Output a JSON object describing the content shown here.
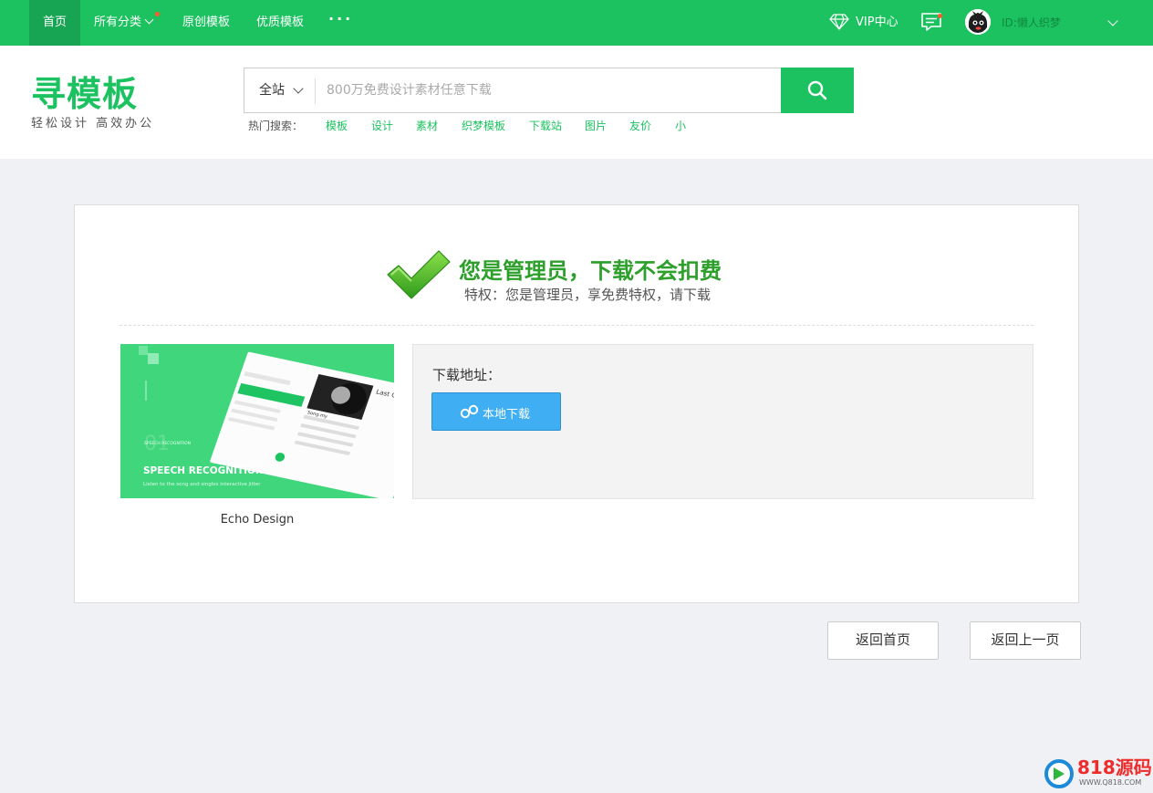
{
  "topnav": {
    "home": "首页",
    "categories": "所有分类",
    "original": "原创模板",
    "quality": "优质模板",
    "more": "···",
    "vip": "VIP中心",
    "user_id": "ID:懒人织梦"
  },
  "header": {
    "logo": "寻模板",
    "slogan": "轻松设计 高效办公",
    "search_scope": "全站",
    "search_placeholder": "800万免费设计素材任意下载",
    "hot_label": "热门搜索：",
    "hot_links": [
      "模板",
      "设计",
      "素材",
      "织梦模板",
      "下载站",
      "图片",
      "友价",
      "小"
    ]
  },
  "main": {
    "title": "您是管理员，下载不会扣费",
    "subtitle": "特权：您是管理员，享免费特权，请下载",
    "thumbnail": {
      "caption": "Echo Design",
      "heading": "SPEECH RECOGNITION",
      "desc": "Listen to the song and singles interactive jitter",
      "num": "01",
      "small": "SPEECH RECOGNITION",
      "mock_title": "Last Classic",
      "mock_song": "Song.my"
    },
    "download_label": "下载地址：",
    "download_button": "本地下载"
  },
  "footer": {
    "back_home": "返回首页",
    "back_prev": "返回上一页"
  },
  "watermark": {
    "brand": "818源码",
    "url": "WWW.Q818.COM"
  },
  "colors": {
    "brand_green": "#1cc160",
    "title_green": "#2d9f2b",
    "download_blue": "#3faef2",
    "page_bg": "#eff1f4"
  }
}
